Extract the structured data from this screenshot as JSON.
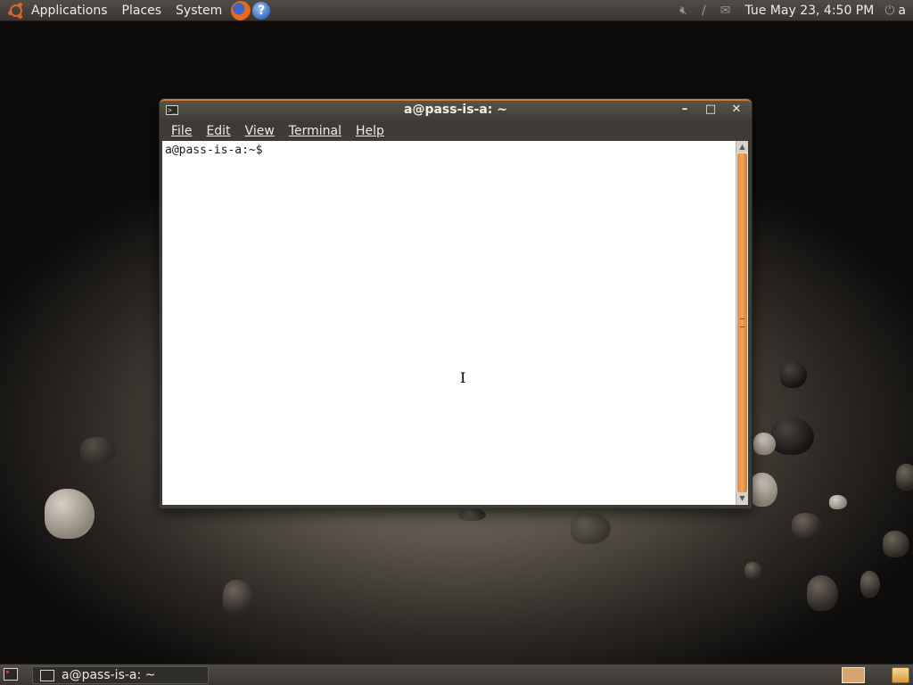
{
  "top_panel": {
    "menus": [
      "Applications",
      "Places",
      "System"
    ],
    "launchers": [
      "firefox-icon",
      "help-icon"
    ],
    "help_glyph": "?",
    "tray_icons": [
      "volume-muted-icon",
      "network-disconnected-icon",
      "mail-icon"
    ],
    "clock": "Tue May 23,  4:50 PM",
    "user": "a"
  },
  "window": {
    "title": "a@pass-is-a: ~",
    "menubar": [
      "File",
      "Edit",
      "View",
      "Terminal",
      "Help"
    ],
    "prompt": "a@pass-is-a:~$",
    "accent": "#d9772e"
  },
  "taskbar": {
    "task_label": "a@pass-is-a: ~"
  }
}
